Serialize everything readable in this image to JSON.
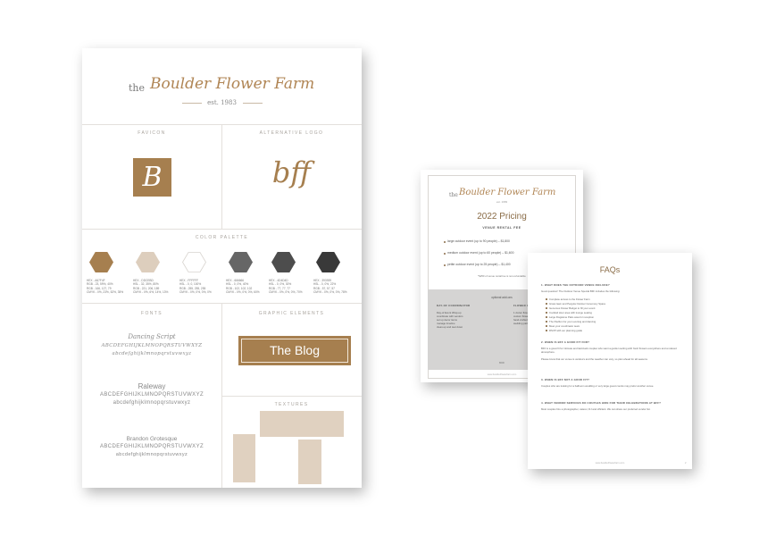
{
  "board": {
    "brand_the": "the",
    "brand_name": "Boulder Flower Farm",
    "brand_est": "est. 1983",
    "favicon_label": "FAVICON",
    "favicon_letter": "B",
    "altlogo_label": "ALTERNATIVE LOGO",
    "altlogo_text": "bff",
    "palette_label": "COLOR PALETTE",
    "swatches": [
      {
        "color": "#a67f4f",
        "lines": [
          "HEX - A67F4F",
          "RGB - 23, 59%, 40%",
          "RGB - 166, 127, 79",
          "CMYK - 0%, 23%, 52%, 35%"
        ]
      },
      {
        "color": "#ddcebd",
        "lines": [
          "HEX - DDCEBD",
          "HSL - 32, 35%, 80%",
          "RGB - 221, 206, 189",
          "CMYK - 0%, 6%, 14%, 13%"
        ]
      },
      {
        "color": "#ffffff",
        "lines": [
          "HEX - FFFFFF",
          "HSL - 0, 0, 100%",
          "RGB - 255, 255, 255",
          "CMYK - 0%, 0%, 0%, 0%"
        ]
      },
      {
        "color": "#666666",
        "lines": [
          "HEX - 666666",
          "HSL - 0, 0%, 40%",
          "RGB - 102, 102, 102",
          "CMYK - 0%, 0%, 0%, 60%"
        ]
      },
      {
        "color": "#4d4d4d",
        "lines": [
          "HEX - 4D4D4D",
          "HSL - 0, 0%, 30%",
          "RGB - 77, 77, 77",
          "CMYK - 0%, 0%, 0%, 70%"
        ]
      },
      {
        "color": "#393939",
        "lines": [
          "HEX - 393939",
          "HSL - 0, 0%, 22%",
          "RGB - 57, 57, 57",
          "CMYK - 0%, 0%, 0%, 78%"
        ]
      }
    ],
    "fonts_label": "FONTS",
    "fonts": [
      {
        "name": "Dancing Script",
        "upper": "ABCDEFGHIJKLMNOPQRSTUVWXYZ",
        "lower": "abcdefghijklmnopqrstuvwxyz"
      },
      {
        "name": "Raleway",
        "upper": "ABCDEFGHIJKLMNOPQRSTUVWXYZ",
        "lower": "abcdefghijklmnopqrstuvwxyz"
      },
      {
        "name": "Brandon Grotesque",
        "upper": "ABCDEFGHIJKLMNOPQRSTUVWXYZ",
        "lower": "abcdefghijklmnopqrstuvwxyz"
      }
    ],
    "graphic_label": "GRAPHIC ELEMENTS",
    "blog_label": "The Blog",
    "textures_label": "TEXTURES"
  },
  "pricing": {
    "brand_the": "the",
    "brand_name": "Boulder Flower Farm",
    "brand_est": "est. 1983",
    "title": "2022 Pricing",
    "subtitle": "VENUE RENTAL FEE",
    "items": [
      "large outdoor event (up to 90 people) – $1,800",
      "medium outdoor event (up to 60 people) – $1,600",
      "petite outdoor event (up to 25 people) – $1,400"
    ],
    "note": "*$250 of venue rental fee is non-refundable",
    "grey_title": "optional add-ons",
    "col1_head": "DAY-OF COORDINATOR",
    "col1_lines": [
      "Day-of Event Wrap-up",
      "coordinate with vendors",
      "set up decor items",
      "manage timeline",
      "clean-up and tear down"
    ],
    "col2_head": "FLOWER CROWNS",
    "col2_lines": [
      "1 dozen flower crowns",
      "custom flowers",
      "hand-crafted",
      "wedding party"
    ],
    "grey_footer": "$500",
    "url": "www.boulderflowerfarm.com"
  },
  "faq": {
    "title": "FAQs",
    "q1": "1. WHAT DOES THE OUTDOOR VENUE INCLUDE?",
    "q1_intro": "Good question! The Outdoor Venue Special BFF includes the following:",
    "q1_items": [
      "Complete access to the Flower Farm",
      "Grass lawn and Pergola Outdoor Ceremony Space",
      "Generous Flower Budget to fill your event",
      "Cocktail Hour area with lounge seating",
      "Large Flagstone Patio area for reception",
      "The Pavilion for your evening and dancing",
      "Meet your coordinator team",
      "RSVP with our planning guide"
    ],
    "q2": "2. WHEN IS BFF A GOOD FIT FOR?",
    "q2_text": "BFF is a great fit for intimate and laid-back couples who want a garden setting with fresh flowers everywhere and a relaxed atmosphere.",
    "q2_text2": "Please know that our venue is outdoors and the weather can vary, so plan ahead for all seasons.",
    "q3": "3. WHEN IS BFF NOT A GOOD FIT?",
    "q3_text": "Couples who are looking for a ballroom wedding or very large guest counts may prefer another venue.",
    "q4": "4. WHAT VENDOR SERVICES DO COUPLES HIRE FOR THEIR CELEBRATIONS AT BFF?",
    "q4_text": "Most couples hire a photographer, caterer, DJ and officiant. We can share our preferred vendor list.",
    "url": "www.boulderflowerfarm.com",
    "page": "2"
  }
}
